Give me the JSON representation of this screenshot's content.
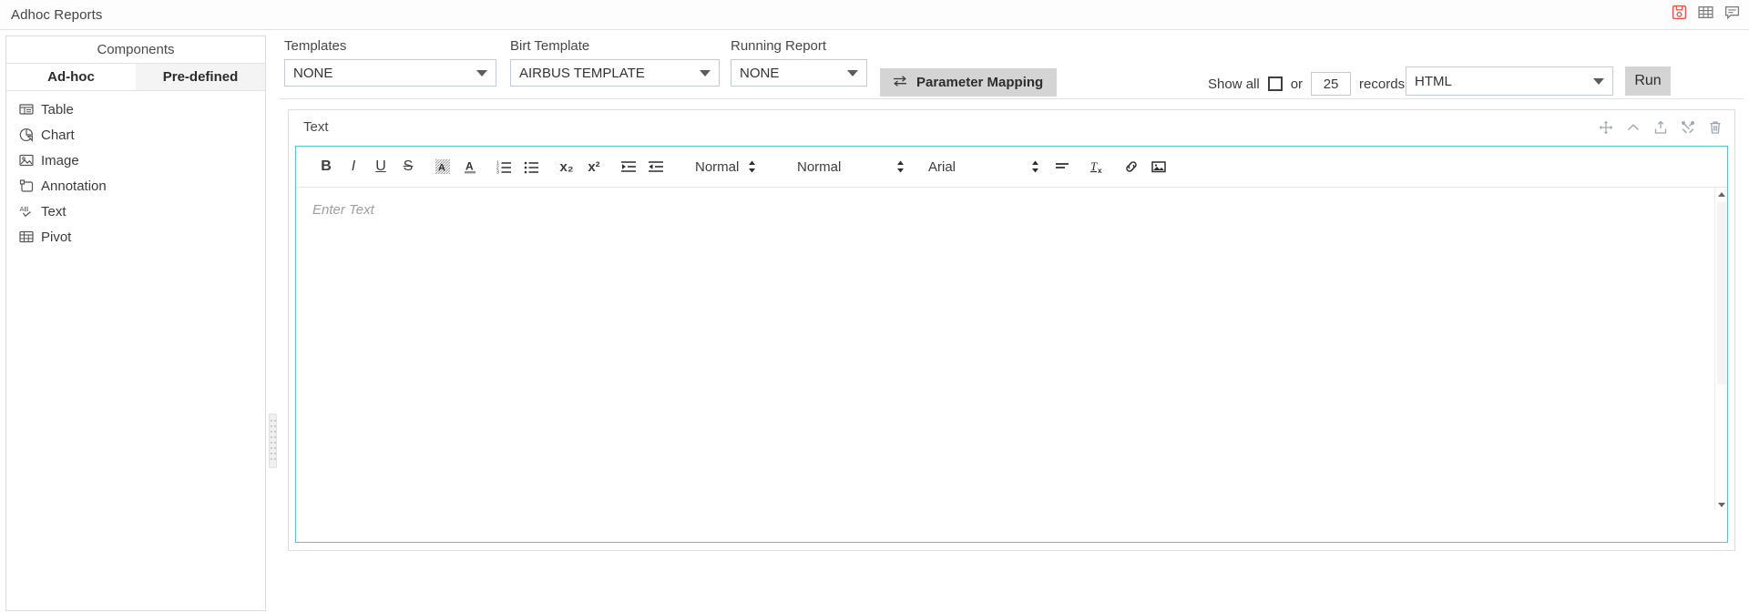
{
  "window": {
    "title": "Adhoc Reports",
    "icons": [
      {
        "name": "save-report-icon",
        "label": "Save"
      },
      {
        "name": "grid-view-icon",
        "label": "Grid"
      },
      {
        "name": "comment-icon",
        "label": "Comments"
      }
    ]
  },
  "sidebar": {
    "header": "Components",
    "tabs": [
      {
        "label": "Ad-hoc",
        "active": true
      },
      {
        "label": "Pre-defined",
        "active": false
      }
    ],
    "items": [
      {
        "label": "Table",
        "icon": "table-icon"
      },
      {
        "label": "Chart",
        "icon": "pie-chart-icon"
      },
      {
        "label": "Image",
        "icon": "image-icon"
      },
      {
        "label": "Annotation",
        "icon": "annotation-icon"
      },
      {
        "label": "Text",
        "icon": "text-ab-icon"
      },
      {
        "label": "Pivot",
        "icon": "pivot-icon"
      }
    ]
  },
  "toolbar": {
    "templates": {
      "label": "Templates",
      "value": "NONE"
    },
    "birt_template": {
      "label": "Birt Template",
      "value": "AIRBUS TEMPLATE"
    },
    "running_report": {
      "label": "Running Report",
      "value": "NONE"
    },
    "parameter_mapping": {
      "label": "Parameter Mapping",
      "icon": "swap-arrows-icon"
    },
    "show_all": {
      "label": "Show all",
      "checked": false
    },
    "or_label": "or",
    "records_value": "25",
    "records_label": "records",
    "format": {
      "value": "HTML"
    },
    "run": {
      "label": "Run"
    }
  },
  "panel": {
    "title": "Text",
    "actions": [
      {
        "name": "move-icon",
        "label": "Move"
      },
      {
        "name": "collapse-chevron-up-icon",
        "label": "Collapse"
      },
      {
        "name": "export-upload-icon",
        "label": "Export"
      },
      {
        "name": "tools-icon",
        "label": "Settings"
      },
      {
        "name": "delete-trash-icon",
        "label": "Delete"
      }
    ]
  },
  "editor": {
    "placeholder": "Enter Text",
    "buttons": [
      {
        "name": "bold-icon",
        "label": "B"
      },
      {
        "name": "italic-icon",
        "label": "I"
      },
      {
        "name": "underline-icon",
        "label": "U"
      },
      {
        "name": "strikethrough-icon",
        "label": "S"
      },
      {
        "name": "highlight-color-icon",
        "label": "A"
      },
      {
        "name": "font-color-icon",
        "label": "A"
      },
      {
        "name": "ordered-list-icon",
        "label": "1."
      },
      {
        "name": "bullet-list-icon",
        "label": "•"
      },
      {
        "name": "subscript-icon",
        "label": "x₂"
      },
      {
        "name": "superscript-icon",
        "label": "x²"
      },
      {
        "name": "outdent-icon",
        "label": "⇤"
      },
      {
        "name": "indent-icon",
        "label": "⇥"
      }
    ],
    "selects": [
      {
        "name": "heading-select",
        "value": "Normal"
      },
      {
        "name": "font-size-select",
        "value": "Normal"
      },
      {
        "name": "font-family-select",
        "value": "Arial"
      }
    ],
    "end_buttons": [
      {
        "name": "align-select",
        "label": "align"
      },
      {
        "name": "clear-format-icon",
        "label": "Tx"
      },
      {
        "name": "link-icon",
        "label": "link"
      },
      {
        "name": "insert-image-icon",
        "label": "image"
      }
    ]
  },
  "colors": {
    "accent": "#5bc3ce",
    "button_grey": "#d4d4d4",
    "border": "#dddddd",
    "save_red": "#e8564b",
    "text": "#3c3c3c"
  }
}
